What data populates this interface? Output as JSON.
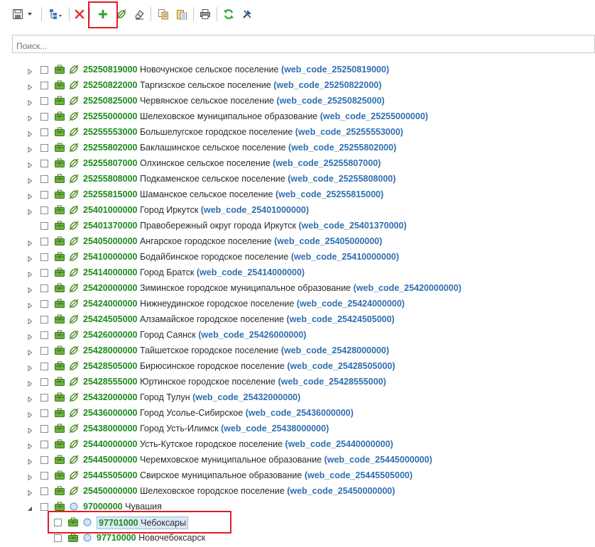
{
  "toolbar": {
    "buttons": [
      {
        "name": "save-icon"
      },
      {
        "name": "dropdown-arrow-icon"
      },
      {
        "name": "tree-structure-icon"
      },
      {
        "name": "delete-icon"
      },
      {
        "name": "add-icon"
      },
      {
        "name": "unlink-icon"
      },
      {
        "name": "eraser-icon"
      },
      {
        "name": "copy-icon"
      },
      {
        "name": "paste-icon"
      },
      {
        "name": "print-icon"
      },
      {
        "name": "refresh-icon"
      },
      {
        "name": "tools-icon"
      }
    ]
  },
  "search": {
    "placeholder": "Поиск..."
  },
  "tree": {
    "rows": [
      {
        "level": 1,
        "expander": "collapsed",
        "icon2": "unlink",
        "code": "25250819000",
        "name": "Новочунское сельское поселение",
        "web": "(web_code_25250819000)"
      },
      {
        "level": 1,
        "expander": "collapsed",
        "icon2": "unlink",
        "code": "25250822000",
        "name": "Таргизское сельское поселение",
        "web": "(web_code_25250822000)"
      },
      {
        "level": 1,
        "expander": "collapsed",
        "icon2": "unlink",
        "code": "25250825000",
        "name": "Червянское сельское поселение",
        "web": "(web_code_25250825000)"
      },
      {
        "level": 1,
        "expander": "collapsed",
        "icon2": "unlink",
        "code": "25255000000",
        "name": "Шелеховское муниципальное образование",
        "web": "(web_code_25255000000)"
      },
      {
        "level": 1,
        "expander": "collapsed",
        "icon2": "unlink",
        "code": "25255553000",
        "name": "Большелугское городское поселение",
        "web": "(web_code_25255553000)"
      },
      {
        "level": 1,
        "expander": "collapsed",
        "icon2": "unlink",
        "code": "25255802000",
        "name": "Баклашинское сельское поселение",
        "web": "(web_code_25255802000)"
      },
      {
        "level": 1,
        "expander": "collapsed",
        "icon2": "unlink",
        "code": "25255807000",
        "name": "Олхинское сельское поселение",
        "web": "(web_code_25255807000)"
      },
      {
        "level": 1,
        "expander": "collapsed",
        "icon2": "unlink",
        "code": "25255808000",
        "name": "Подкаменское сельское поселение",
        "web": "(web_code_25255808000)"
      },
      {
        "level": 1,
        "expander": "collapsed",
        "icon2": "unlink",
        "code": "25255815000",
        "name": "Шаманское сельское поселение",
        "web": "(web_code_25255815000)"
      },
      {
        "level": 1,
        "expander": "collapsed",
        "icon2": "unlink",
        "code": "25401000000",
        "name": "Город Иркутск",
        "web": "(web_code_25401000000)"
      },
      {
        "level": 1,
        "expander": "none",
        "icon2": "unlink",
        "code": "25401370000",
        "name": "Правобережный округ города Иркутск",
        "web": "(web_code_25401370000)"
      },
      {
        "level": 1,
        "expander": "collapsed",
        "icon2": "unlink",
        "code": "25405000000",
        "name": "Ангарское городское поселение",
        "web": "(web_code_25405000000)"
      },
      {
        "level": 1,
        "expander": "collapsed",
        "icon2": "unlink",
        "code": "25410000000",
        "name": "Бодайбинское городское поселение",
        "web": "(web_code_25410000000)"
      },
      {
        "level": 1,
        "expander": "collapsed",
        "icon2": "unlink",
        "code": "25414000000",
        "name": "Город Братск",
        "web": "(web_code_25414000000)"
      },
      {
        "level": 1,
        "expander": "collapsed",
        "icon2": "unlink",
        "code": "25420000000",
        "name": "Зиминское городское муниципальное образование",
        "web": "(web_code_25420000000)"
      },
      {
        "level": 1,
        "expander": "collapsed",
        "icon2": "unlink",
        "code": "25424000000",
        "name": "Нижнеудинское городское поселение",
        "web": "(web_code_25424000000)"
      },
      {
        "level": 1,
        "expander": "collapsed",
        "icon2": "unlink",
        "code": "25424505000",
        "name": "Алзамайское городское поселение",
        "web": "(web_code_25424505000)"
      },
      {
        "level": 1,
        "expander": "collapsed",
        "icon2": "unlink",
        "code": "25426000000",
        "name": "Город Саянск",
        "web": "(web_code_25426000000)"
      },
      {
        "level": 1,
        "expander": "collapsed",
        "icon2": "unlink",
        "code": "25428000000",
        "name": "Тайшетское городское поселение",
        "web": "(web_code_25428000000)"
      },
      {
        "level": 1,
        "expander": "collapsed",
        "icon2": "unlink",
        "code": "25428505000",
        "name": "Бирюсинское городское поселение",
        "web": "(web_code_25428505000)"
      },
      {
        "level": 1,
        "expander": "collapsed",
        "icon2": "unlink",
        "code": "25428555000",
        "name": "Юртинское городское поселение",
        "web": "(web_code_25428555000)"
      },
      {
        "level": 1,
        "expander": "collapsed",
        "icon2": "unlink",
        "code": "25432000000",
        "name": "Город Тулун",
        "web": "(web_code_25432000000)"
      },
      {
        "level": 1,
        "expander": "collapsed",
        "icon2": "unlink",
        "code": "25436000000",
        "name": "Город Усолье-Сибирское",
        "web": "(web_code_25436000000)"
      },
      {
        "level": 1,
        "expander": "collapsed",
        "icon2": "unlink",
        "code": "25438000000",
        "name": "Город Усть-Илимск",
        "web": "(web_code_25438000000)"
      },
      {
        "level": 1,
        "expander": "collapsed",
        "icon2": "unlink",
        "code": "25440000000",
        "name": "Усть-Кутское городское поселение",
        "web": "(web_code_25440000000)"
      },
      {
        "level": 1,
        "expander": "collapsed",
        "icon2": "unlink",
        "code": "25445000000",
        "name": "Черемховское муниципальное образование",
        "web": "(web_code_25445000000)"
      },
      {
        "level": 1,
        "expander": "collapsed",
        "icon2": "unlink",
        "code": "25445505000",
        "name": "Свирское муниципальное образование",
        "web": "(web_code_25445505000)"
      },
      {
        "level": 1,
        "expander": "collapsed",
        "icon2": "unlink",
        "code": "25450000000",
        "name": "Шелеховское городское поселение",
        "web": "(web_code_25450000000)"
      },
      {
        "level": 1,
        "expander": "expanded",
        "icon2": "circle",
        "code": "97000000",
        "name": "Чувашия",
        "web": ""
      },
      {
        "level": 2,
        "expander": "none",
        "icon2": "circle",
        "code": "97701000",
        "name": "Чебоксары",
        "web": "",
        "selected": true
      },
      {
        "level": 2,
        "expander": "none",
        "icon2": "circle",
        "code": "97710000",
        "name": "Новочебоксарск",
        "web": ""
      }
    ]
  }
}
